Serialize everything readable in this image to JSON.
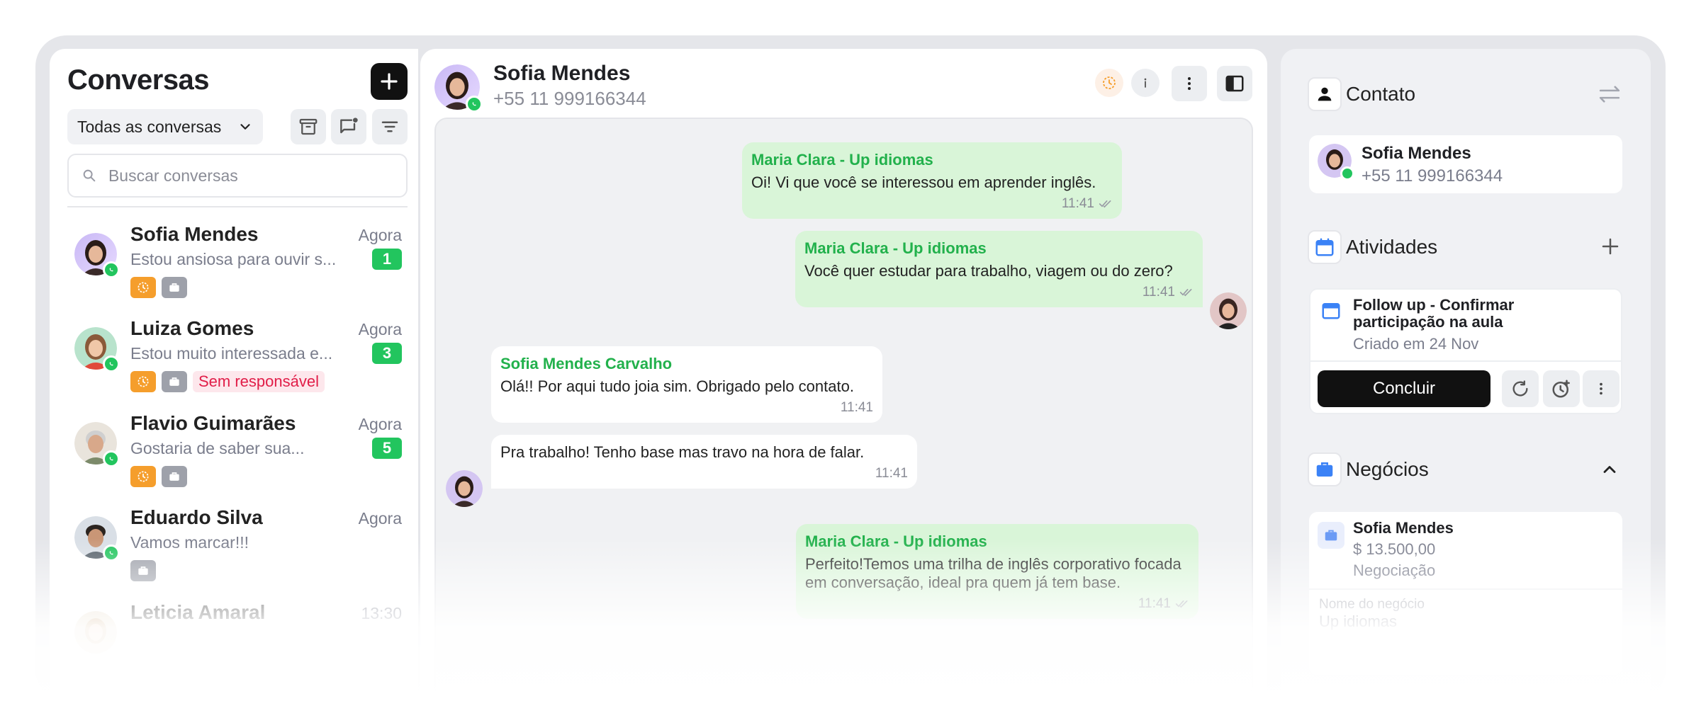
{
  "conversations_panel": {
    "title": "Conversas",
    "filter_label": "Todas as conversas",
    "search_placeholder": "Buscar conversas",
    "items": [
      {
        "name": "Sofia Mendes",
        "time": "Agora",
        "preview": "Estou ansiosa para ouvir s...",
        "unread": "1",
        "tag_label": ""
      },
      {
        "name": "Luiza Gomes",
        "time": "Agora",
        "preview": "Estou muito interessada e...",
        "unread": "3",
        "tag_label": "Sem responsável"
      },
      {
        "name": "Flavio Guimarães",
        "time": "Agora",
        "preview": "Gostaria de saber sua...",
        "unread": "5",
        "tag_label": ""
      },
      {
        "name": "Eduardo Silva",
        "time": "Agora",
        "preview": "Vamos marcar!!!",
        "unread": "",
        "tag_label": ""
      },
      {
        "name": "Leticia Amaral",
        "time": "13:30",
        "preview": "",
        "unread": "",
        "tag_label": ""
      }
    ]
  },
  "chat": {
    "contact_name": "Sofia Mendes",
    "contact_phone": "+55 11 999166344",
    "messages": [
      {
        "sender": "Maria Clara - Up idiomas",
        "text": "Oi! Vi que você se interessou em aprender inglês.",
        "time": "11:41"
      },
      {
        "sender": "Maria Clara - Up idiomas",
        "text": "Você quer estudar para trabalho, viagem ou do zero?",
        "time": "11:41"
      },
      {
        "sender": "Sofia Mendes Carvalho",
        "text": "Olá!! Por aqui tudo joia sim. Obrigado pelo contato.",
        "time": "11:41"
      },
      {
        "sender": "",
        "text": "Pra trabalho! Tenho base mas travo na hora de falar.",
        "time": "11:41"
      },
      {
        "sender": "Maria Clara - Up idiomas",
        "text": "Perfeito!Temos uma trilha de inglês corporativo focada em conversação, ideal pra quem já tem base.",
        "time": "11:41"
      }
    ]
  },
  "sidebar": {
    "contact": {
      "title": "Contato",
      "name": "Sofia Mendes",
      "phone": "+55 11 999166344"
    },
    "activities": {
      "title": "Atividades",
      "item_title": "Follow up - Confirmar participação na aula",
      "item_sub": "Criado em 24 Nov",
      "complete_label": "Concluir"
    },
    "deals": {
      "title": "Negócios",
      "name": "Sofia Mendes",
      "value": "$ 13.500,00",
      "stage": "Negociação",
      "field_label": "Nome do negócio",
      "field_value": "Up idiomas"
    }
  },
  "colors": {
    "accent_green": "#22c55e",
    "tag_orange": "#f59e2c",
    "tag_red": "#e11d48",
    "blue_icon": "#3b82f6"
  }
}
